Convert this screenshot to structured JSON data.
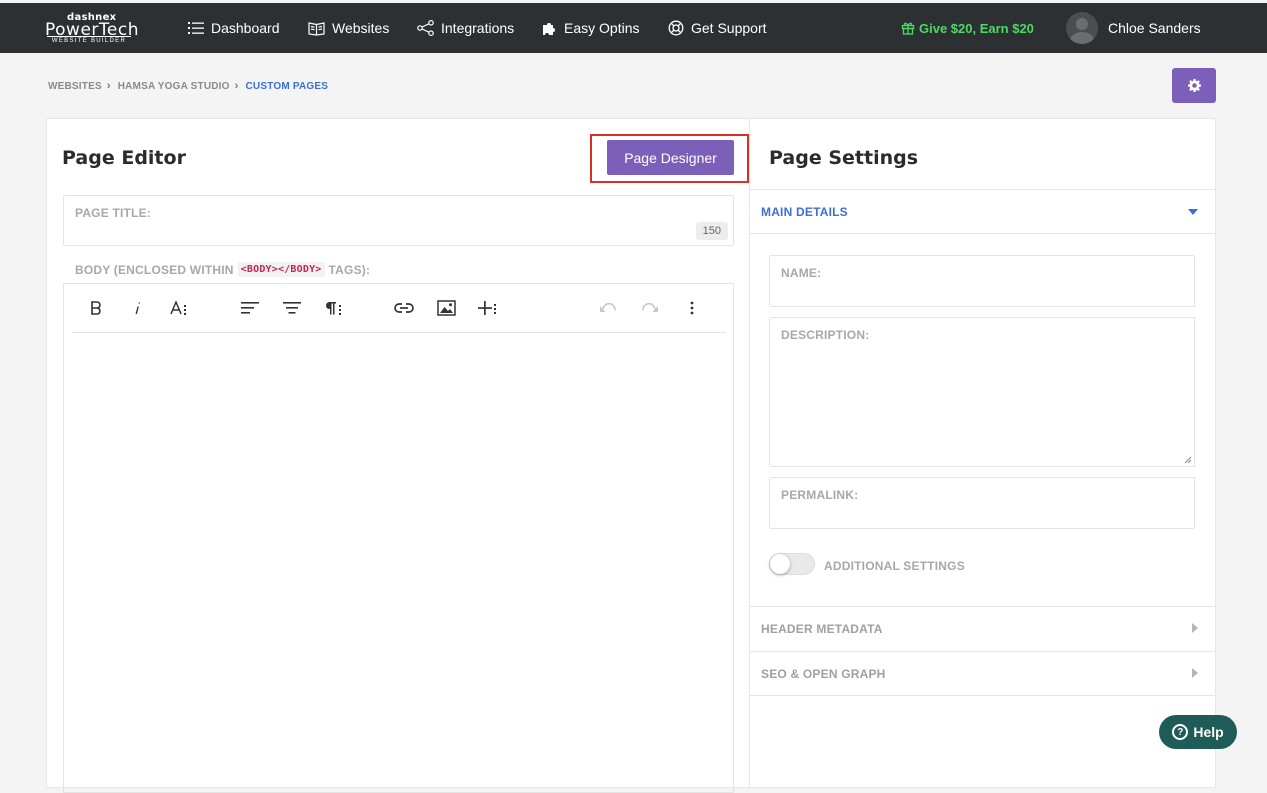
{
  "brand": {
    "line1": "dashnex",
    "line2": "PowerTech",
    "line3": "WEBSITE BUILDER"
  },
  "nav": {
    "items": [
      {
        "label": "Dashboard",
        "icon": "list-icon"
      },
      {
        "label": "Websites",
        "icon": "book-icon"
      },
      {
        "label": "Integrations",
        "icon": "share-icon"
      },
      {
        "label": "Easy Optins",
        "icon": "puzzle-icon"
      },
      {
        "label": "Get Support",
        "icon": "lifebuoy-icon"
      }
    ],
    "promo": "Give $20, Earn $20",
    "user": "Chloe Sanders"
  },
  "breadcrumb": [
    "WEBSITES",
    "HAMSA YOGA STUDIO",
    "CUSTOM PAGES"
  ],
  "editor": {
    "title": "Page Editor",
    "designer_button": "Page Designer",
    "page_title_label": "PAGE TITLE:",
    "page_title_counter": "150",
    "body_label_prefix": "BODY (ENCLOSED WITHIN",
    "body_label_code": "<BODY></BODY>",
    "body_label_suffix": "TAGS):"
  },
  "settings": {
    "title": "Page Settings",
    "main_details": "MAIN DETAILS",
    "name_label": "NAME:",
    "description_label": "DESCRIPTION:",
    "permalink_label": "PERMALINK:",
    "additional_settings": "ADDITIONAL SETTINGS",
    "additional_settings_on": false,
    "header_metadata": "HEADER METADATA",
    "seo": "SEO & OPEN GRAPH"
  },
  "help": "Help",
  "colors": {
    "nav_bg": "#2d3033",
    "accent": "#7b5fb8",
    "link": "#3d6fd6",
    "promo": "#4cd964",
    "highlight": "#d93025",
    "help_bg": "#1f5b57"
  }
}
